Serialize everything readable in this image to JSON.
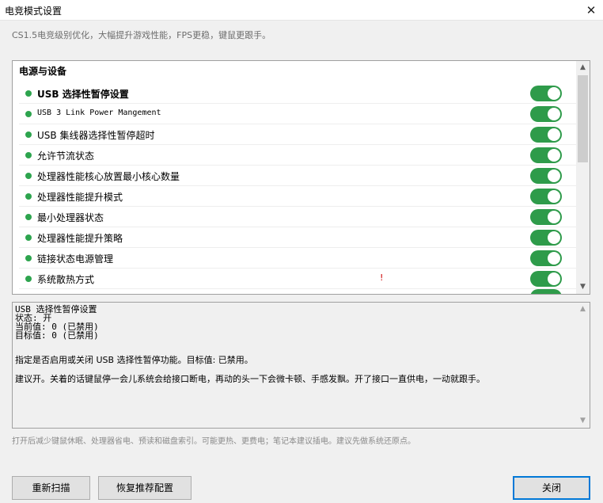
{
  "window": {
    "title": "电竞模式设置",
    "close_glyph": "✕"
  },
  "subtitle": "CS1.5电竞级别优化，大幅提升游戏性能，FPS更稳，键鼠更跟手。",
  "section": {
    "title": "电源与设备",
    "items": [
      {
        "label": "USB 选择性暂停设置",
        "enabled": true
      },
      {
        "label": "USB 3 Link Power Mangement",
        "enabled": true
      },
      {
        "label": "USB 集线器选择性暂停超时",
        "enabled": true
      },
      {
        "label": "允许节流状态",
        "enabled": true
      },
      {
        "label": "处理器性能核心放置最小核心数量",
        "enabled": true
      },
      {
        "label": "处理器性能提升模式",
        "enabled": true
      },
      {
        "label": "最小处理器状态",
        "enabled": true
      },
      {
        "label": "处理器性能提升策略",
        "enabled": true
      },
      {
        "label": "链接状态电源管理",
        "enabled": true
      },
      {
        "label": "系统散热方式",
        "enabled": true
      }
    ],
    "marker": "!",
    "dot_color": "#2da44e",
    "toggle_color": "#2e9b4a"
  },
  "detail": {
    "name": "USB 选择性暂停设置",
    "state": "状态: 开",
    "current": "当前值: 0 (已禁用)",
    "target": "目标值: 0 (已禁用)",
    "description": "指定是否启用或关闭 USB 选择性暂停功能。目标值: 已禁用。",
    "advice": "建议开。关着的话键鼠停一会儿系统会给接口断电，再动的头一下会微卡顿、手感发飘。开了接口一直供电，一动就跟手。"
  },
  "footnote": "打开后减少键鼠休眠、处理器省电、预读和磁盘索引。可能更热、更费电；笔记本建议插电。建议先做系统还原点。",
  "buttons": {
    "rescan": "重新扫描",
    "restore": "恢复推荐配置",
    "close": "关闭"
  },
  "accent": "#0078d7"
}
